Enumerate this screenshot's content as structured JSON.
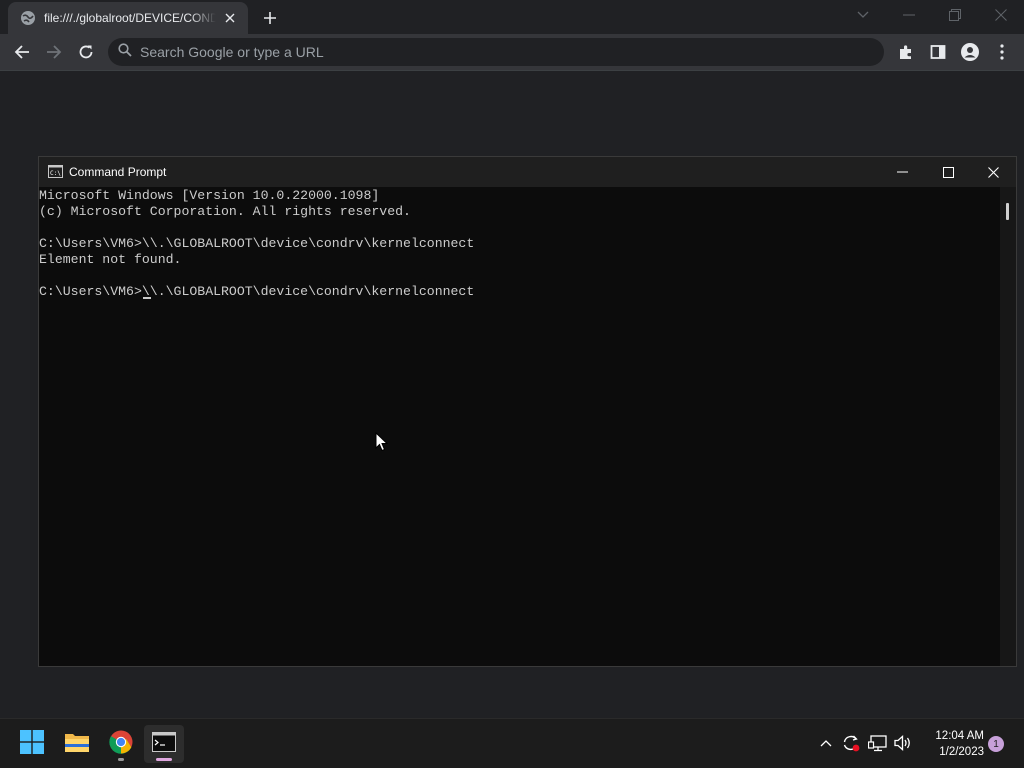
{
  "browser": {
    "tab": {
      "title": "file:///./globalroot/DEVICE/CONDRV/KERNELCONNECT",
      "icon": "globe-icon"
    },
    "omnibox": {
      "placeholder": "Search Google or type a URL",
      "value": ""
    },
    "colors": {
      "frame": "#202124",
      "toolbar": "#35363a",
      "text": "#e8eaed"
    }
  },
  "cmd_window": {
    "title": "Command Prompt",
    "lines": [
      "Microsoft Windows [Version 10.0.22000.1098]",
      "(c) Microsoft Corporation. All rights reserved.",
      "",
      "C:\\Users\\VM6>\\\\.\\GLOBALROOT\\device\\condrv\\kernelconnect",
      "Element not found.",
      "",
      "C:\\Users\\VM6>\\\\.\\GLOBALROOT\\device\\condrv\\kernelconnect"
    ],
    "colors": {
      "background": "#0c0c0c",
      "text": "#cccccc",
      "titlebar": "#1f1f1f"
    }
  },
  "taskbar": {
    "apps": [
      {
        "name": "Start",
        "icon": "windows-start-icon"
      },
      {
        "name": "File Explorer",
        "icon": "folder-icon"
      },
      {
        "name": "Google Chrome",
        "icon": "chrome-icon"
      },
      {
        "name": "Command Prompt",
        "icon": "terminal-icon"
      }
    ],
    "clock": {
      "time": "12:04 AM",
      "date": "1/2/2023"
    },
    "notification_count": "1"
  }
}
